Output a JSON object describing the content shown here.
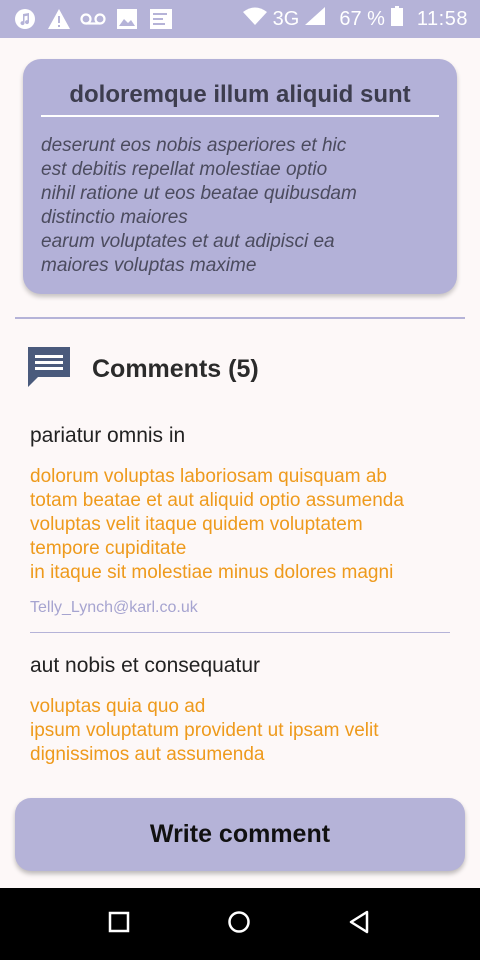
{
  "status_bar": {
    "left_icons": [
      "music-icon",
      "warning-icon",
      "voicemail-icon",
      "image-icon",
      "notes-icon"
    ],
    "network": "3G",
    "battery": "67 %",
    "time": "11:58"
  },
  "card": {
    "title": "doloremque illum aliquid sunt",
    "body": "deserunt eos nobis asperiores et hic\nest debitis repellat molestiae optio\nnihil ratione ut eos beatae quibusdam\ndistinctio maiores\nearum voluptates et aut adipisci ea\nmaiores voluptas maxime"
  },
  "comments": {
    "header": "Comments (5)",
    "items": [
      {
        "title": "pariatur omnis in",
        "body": "dolorum voluptas laboriosam quisquam ab\ntotam beatae et aut aliquid optio assumenda\nvoluptas velit itaque quidem voluptatem\ntempore cupiditate\nin itaque sit molestiae minus dolores magni",
        "email": "Telly_Lynch@karl.co.uk"
      },
      {
        "title": "aut nobis et consequatur",
        "body": "voluptas quia quo ad\nipsum voluptatum provident ut ipsam velit\ndignissimos aut assumenda",
        "email": ""
      }
    ]
  },
  "write_button": "Write comment",
  "colors": {
    "accent": "#b5b3d8",
    "comment_body": "#ee9a1c",
    "email": "#a6a4d0",
    "background": "#fdf8f8"
  },
  "nav_bar": [
    "recents-icon",
    "home-icon",
    "back-icon"
  ]
}
